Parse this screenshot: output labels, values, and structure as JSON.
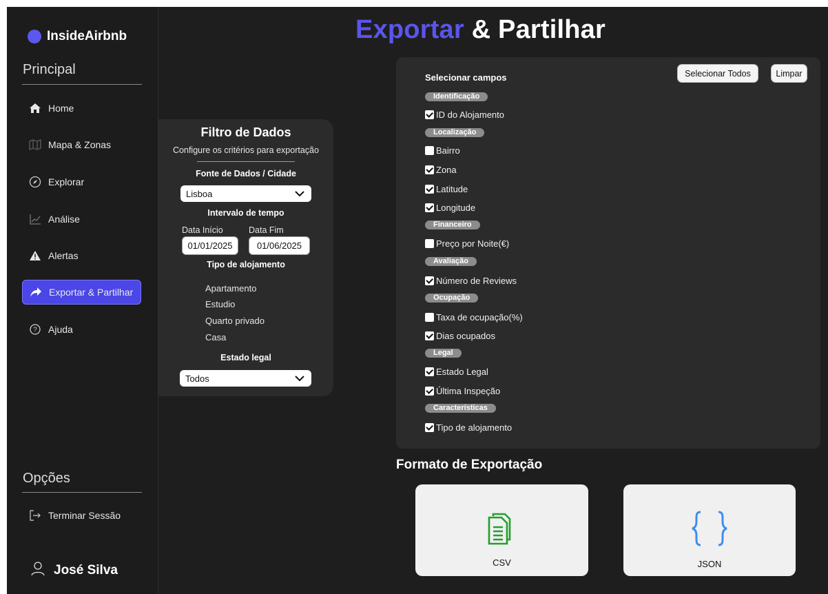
{
  "app": {
    "name": "InsideAirbnb",
    "accent": "#5b57ef"
  },
  "sidebar": {
    "section_main": "Principal",
    "items": [
      {
        "label": "Home",
        "icon": "home-icon"
      },
      {
        "label": "Mapa & Zonas",
        "icon": "map-icon"
      },
      {
        "label": "Explorar",
        "icon": "compass-icon"
      },
      {
        "label": "Análise",
        "icon": "chart-icon"
      },
      {
        "label": "Alertas",
        "icon": "alert-icon"
      },
      {
        "label": "Exportar & Partilhar",
        "icon": "share-arrow-icon",
        "active": true
      },
      {
        "label": "Ajuda",
        "icon": "help-icon"
      }
    ],
    "section_options": "Opções",
    "logout": "Terminar Sessão",
    "user": "José Silva"
  },
  "header": {
    "title_accent": "Exportar",
    "title_rest": " & Partilhar"
  },
  "filter": {
    "title": "Filtro de Dados",
    "subtitle": "Configure os critérios para exportação",
    "source_label": "Fonte de Dados / Cidade",
    "source_value": "Lisboa",
    "interval_label": "Intervalo de tempo",
    "start_label": "Data Início",
    "end_label": "Data Fim",
    "start_value": "01/01/2025",
    "end_value": "01/06/2025",
    "type_label": "Tipo de alojamento",
    "types": [
      "Apartamento",
      "Estudio",
      "Quarto privado",
      "Casa"
    ],
    "legal_label": "Estado legal",
    "legal_value": "Todos"
  },
  "fields": {
    "title": "Selecionar campos",
    "select_all": "Selecionar Todos",
    "clear": "Limpar",
    "groups": [
      {
        "name": "Identificação",
        "items": [
          {
            "label": "ID do Alojamento",
            "checked": true
          }
        ]
      },
      {
        "name": "Localização",
        "items": [
          {
            "label": "Bairro",
            "checked": false
          },
          {
            "label": "Zona",
            "checked": true
          },
          {
            "label": "Latitude",
            "checked": true
          },
          {
            "label": "Longitude",
            "checked": true
          }
        ]
      },
      {
        "name": "Financeiro",
        "items": [
          {
            "label": "Preço por Noite(€)",
            "checked": false
          }
        ]
      },
      {
        "name": "Avaliação",
        "items": [
          {
            "label": "Número de Reviews",
            "checked": true
          }
        ]
      },
      {
        "name": "Ocupação",
        "items": [
          {
            "label": "Taxa de ocupação(%)",
            "checked": false
          },
          {
            "label": "Dias ocupados",
            "checked": true
          }
        ]
      },
      {
        "name": "Legal",
        "items": [
          {
            "label": "Estado Legal",
            "checked": true
          },
          {
            "label": "Última Inspeção",
            "checked": true
          }
        ]
      },
      {
        "name": "Características",
        "items": [
          {
            "label": "Tipo de alojamento",
            "checked": true
          }
        ]
      }
    ]
  },
  "export": {
    "title": "Formato de Exportação",
    "csv_label": "CSV",
    "json_label": "JSON",
    "csv_color": "#22a02c",
    "json_color": "#3b8ef0"
  }
}
